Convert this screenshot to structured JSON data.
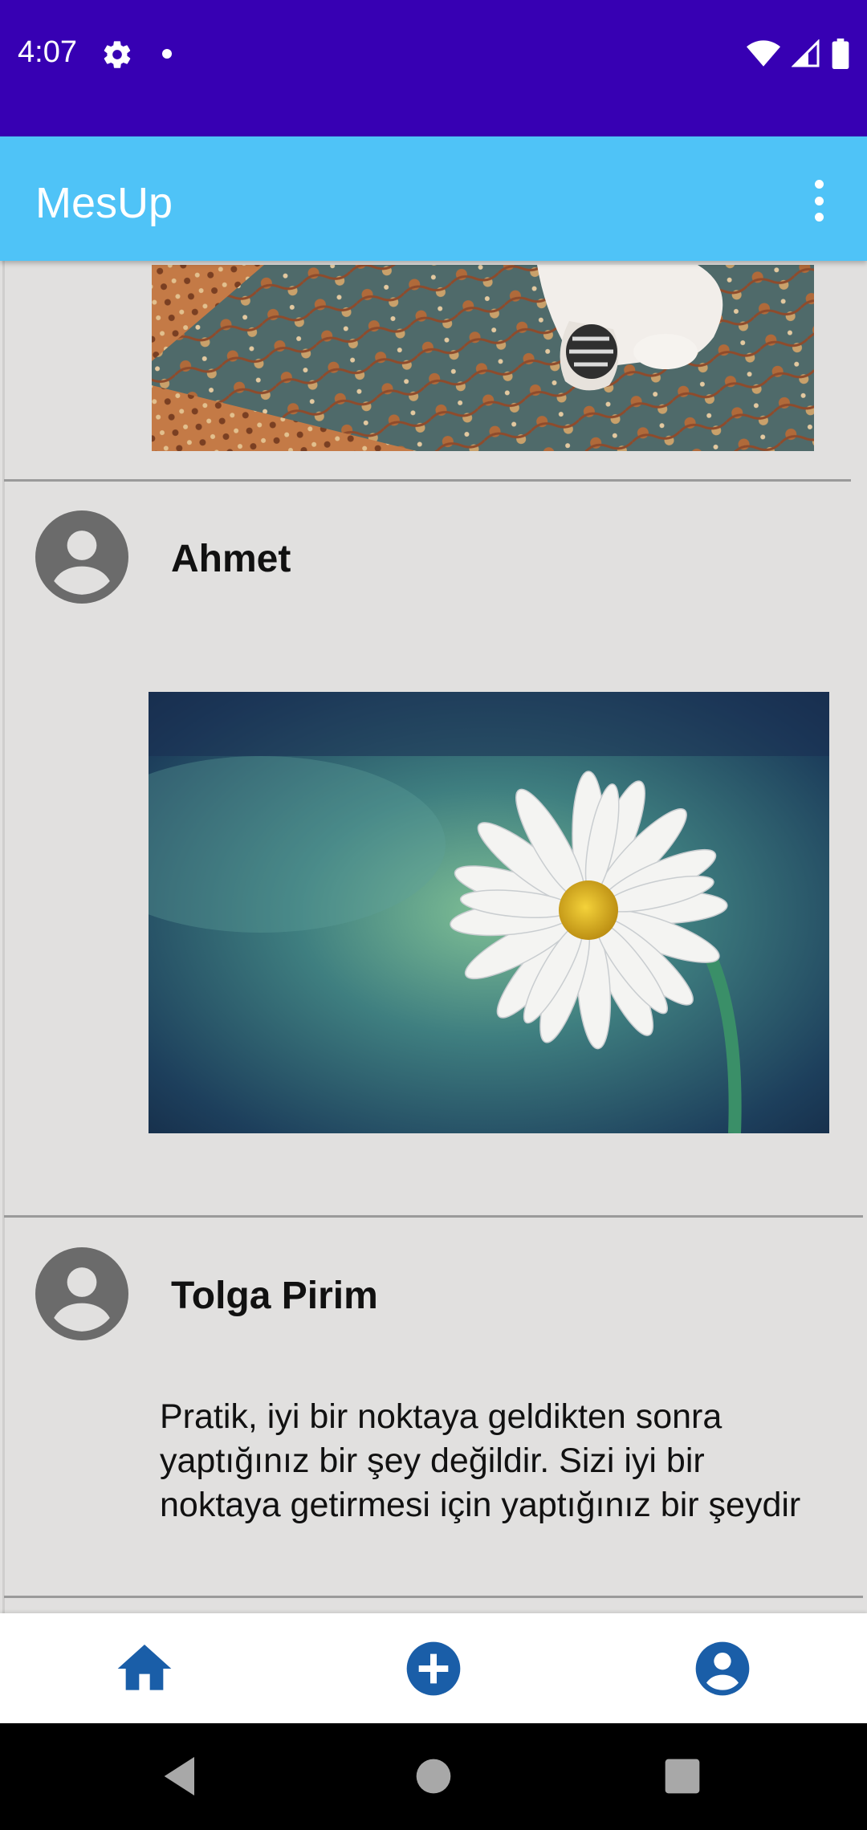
{
  "status_bar": {
    "time": "4:07",
    "icons": [
      "gear-icon",
      "notification-dot-icon",
      "wifi-icon",
      "signal-icon",
      "battery-icon"
    ],
    "background": "#3700b3"
  },
  "app_bar": {
    "title": "MesUp",
    "background": "#4fc3f7",
    "menu_icon": "more-vert-icon"
  },
  "feed": {
    "posts": [
      {
        "author": "",
        "image": "prayer-carpet-photo"
      },
      {
        "author": "Ahmet",
        "image": "daisy-photo"
      },
      {
        "author": "Tolga Pirim",
        "text": "Pratik, iyi bir noktaya geldikten sonra yaptığınız bir şey değildir. Sizi iyi bir noktaya getirmesi için yaptığınız bir şeydir"
      }
    ]
  },
  "bottom_nav": {
    "items": [
      {
        "icon": "home-icon"
      },
      {
        "icon": "add-circle-icon"
      },
      {
        "icon": "account-circle-icon"
      }
    ],
    "accent": "#1a5ea8"
  },
  "system_nav": {
    "buttons": [
      "back-icon",
      "home-circle-icon",
      "recents-icon"
    ]
  }
}
